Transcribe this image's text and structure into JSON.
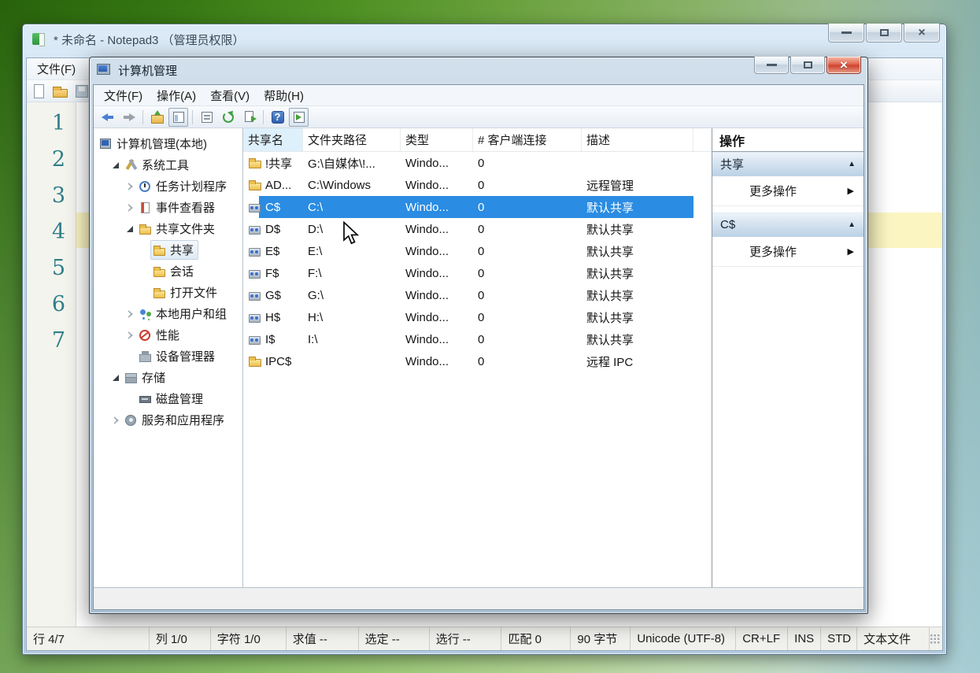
{
  "notepad": {
    "title": "* 未命名 - Notepad3 （管理员权限）",
    "menu": [
      {
        "label": "文件(F)"
      }
    ],
    "toolbar": [
      "new-file-icon",
      "open-file-icon",
      "save-file-icon"
    ],
    "line_numbers": [
      "1",
      "2",
      "3",
      "4",
      "5",
      "6",
      "7"
    ],
    "current_line": "4",
    "status": [
      "行 4/7",
      "列 1/0",
      "字符 1/0",
      "求值 --",
      "选定 --",
      "选行 --",
      "匹配 0",
      "90 字节",
      "Unicode (UTF-8)",
      "CR+LF",
      "INS",
      "STD",
      "文本文件"
    ],
    "window_buttons": [
      "minimize",
      "maximize",
      "close"
    ]
  },
  "mmc": {
    "title": "计算机管理",
    "menu": [
      {
        "label": "文件(F)"
      },
      {
        "label": "操作(A)"
      },
      {
        "label": "查看(V)"
      },
      {
        "label": "帮助(H)"
      }
    ],
    "toolbar": [
      "back",
      "forward",
      "sep",
      "up-level",
      "toggle-console-tree",
      "sep",
      "properties",
      "refresh",
      "export-list",
      "sep",
      "help",
      "toggle-action-pane"
    ],
    "tree": [
      {
        "level": 0,
        "arrow": "none",
        "icon": "computer",
        "label": "计算机管理(本地)"
      },
      {
        "level": 1,
        "arrow": "expanded",
        "icon": "tools",
        "label": "系统工具"
      },
      {
        "level": 2,
        "arrow": "collapsed",
        "icon": "clock",
        "label": "任务计划程序"
      },
      {
        "level": 2,
        "arrow": "collapsed",
        "icon": "log",
        "label": "事件查看器"
      },
      {
        "level": 2,
        "arrow": "expanded",
        "icon": "shared-folder",
        "label": "共享文件夹"
      },
      {
        "level": 3,
        "arrow": "none",
        "icon": "shared-folder",
        "label": "共享",
        "selected": true
      },
      {
        "level": 3,
        "arrow": "none",
        "icon": "shared-folder",
        "label": "会话"
      },
      {
        "level": 3,
        "arrow": "none",
        "icon": "shared-folder",
        "label": "打开文件"
      },
      {
        "level": 2,
        "arrow": "collapsed",
        "icon": "users",
        "label": "本地用户和组"
      },
      {
        "level": 2,
        "arrow": "collapsed",
        "icon": "performance",
        "label": "性能"
      },
      {
        "level": 2,
        "arrow": "none",
        "icon": "device-manager",
        "label": "设备管理器"
      },
      {
        "level": 1,
        "arrow": "expanded",
        "icon": "storage",
        "label": "存储"
      },
      {
        "level": 2,
        "arrow": "none",
        "icon": "disk",
        "label": "磁盘管理"
      },
      {
        "level": 1,
        "arrow": "collapsed",
        "icon": "services",
        "label": "服务和应用程序"
      }
    ],
    "list": {
      "columns": [
        "共享名",
        "文件夹路径",
        "类型",
        "# 客户端连接",
        "描述"
      ],
      "rows": [
        {
          "icon": "shared-folder",
          "share": "!共享",
          "path": "G:\\自媒体\\!...",
          "type": "Windo...",
          "clients": "0",
          "desc": ""
        },
        {
          "icon": "shared-folder",
          "share": "AD...",
          "path": "C:\\Windows",
          "type": "Windo...",
          "clients": "0",
          "desc": "远程管理"
        },
        {
          "icon": "drive-share",
          "share": "C$",
          "path": "C:\\",
          "type": "Windo...",
          "clients": "0",
          "desc": "默认共享",
          "selected": true
        },
        {
          "icon": "drive-share",
          "share": "D$",
          "path": "D:\\",
          "type": "Windo...",
          "clients": "0",
          "desc": "默认共享"
        },
        {
          "icon": "drive-share",
          "share": "E$",
          "path": "E:\\",
          "type": "Windo...",
          "clients": "0",
          "desc": "默认共享"
        },
        {
          "icon": "drive-share",
          "share": "F$",
          "path": "F:\\",
          "type": "Windo...",
          "clients": "0",
          "desc": "默认共享"
        },
        {
          "icon": "drive-share",
          "share": "G$",
          "path": "G:\\",
          "type": "Windo...",
          "clients": "0",
          "desc": "默认共享"
        },
        {
          "icon": "drive-share",
          "share": "H$",
          "path": "H:\\",
          "type": "Windo...",
          "clients": "0",
          "desc": "默认共享"
        },
        {
          "icon": "drive-share",
          "share": "I$",
          "path": "I:\\",
          "type": "Windo...",
          "clients": "0",
          "desc": "默认共享"
        },
        {
          "icon": "shared-folder",
          "share": "IPC$",
          "path": "",
          "type": "Windo...",
          "clients": "0",
          "desc": "远程 IPC"
        }
      ]
    },
    "actions": {
      "title": "操作",
      "sections": [
        {
          "title": "共享",
          "collapse_icon": "chevron-up",
          "items": [
            {
              "label": "更多操作",
              "arrow": "submenu-right"
            }
          ]
        },
        {
          "title": "C$",
          "collapse_icon": "chevron-up",
          "items": [
            {
              "label": "更多操作",
              "arrow": "submenu-right"
            }
          ]
        }
      ]
    },
    "window_buttons": [
      "minimize",
      "maximize",
      "close"
    ]
  },
  "colors": {
    "selection_blue": "#2a8ce2",
    "close_button_red": "#d8492f",
    "wallpaper_green": "#3f8a14",
    "wallpaper_teal": "#7fb6c0",
    "line_number_teal": "#2f7f88",
    "current_line_highlight": "#fbf5c2",
    "sorted_column": "#def0fb"
  }
}
